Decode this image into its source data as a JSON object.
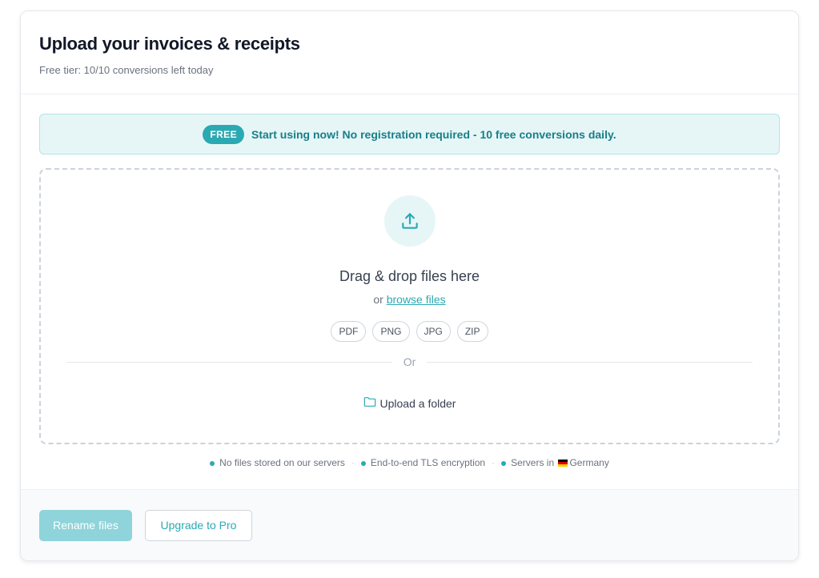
{
  "header": {
    "title": "Upload your invoices & receipts",
    "subtitle": "Free tier: 10/10 conversions left today"
  },
  "banner": {
    "badge": "FREE",
    "text": "Start using now! No registration required - 10 free conversions daily."
  },
  "dropzone": {
    "icon": "upload-icon",
    "title": "Drag & drop files here",
    "or_prefix": "or",
    "browse_link": "browse files",
    "formats": [
      "PDF",
      "PNG",
      "JPG",
      "ZIP"
    ],
    "divider_text": "Or",
    "folder_icon": "folder-icon",
    "folder_label": "Upload a folder"
  },
  "trust": {
    "items": [
      "No files stored on our servers",
      "End-to-end TLS encryption",
      "Servers in",
      "Germany"
    ],
    "separator": "·"
  },
  "footer": {
    "rename_label": "Rename files",
    "upgrade_label": "Upgrade to Pro"
  },
  "colors": {
    "accent": "#2ba9b3",
    "accent_light": "#e6f6f7",
    "primary_disabled": "#8fd4da"
  }
}
